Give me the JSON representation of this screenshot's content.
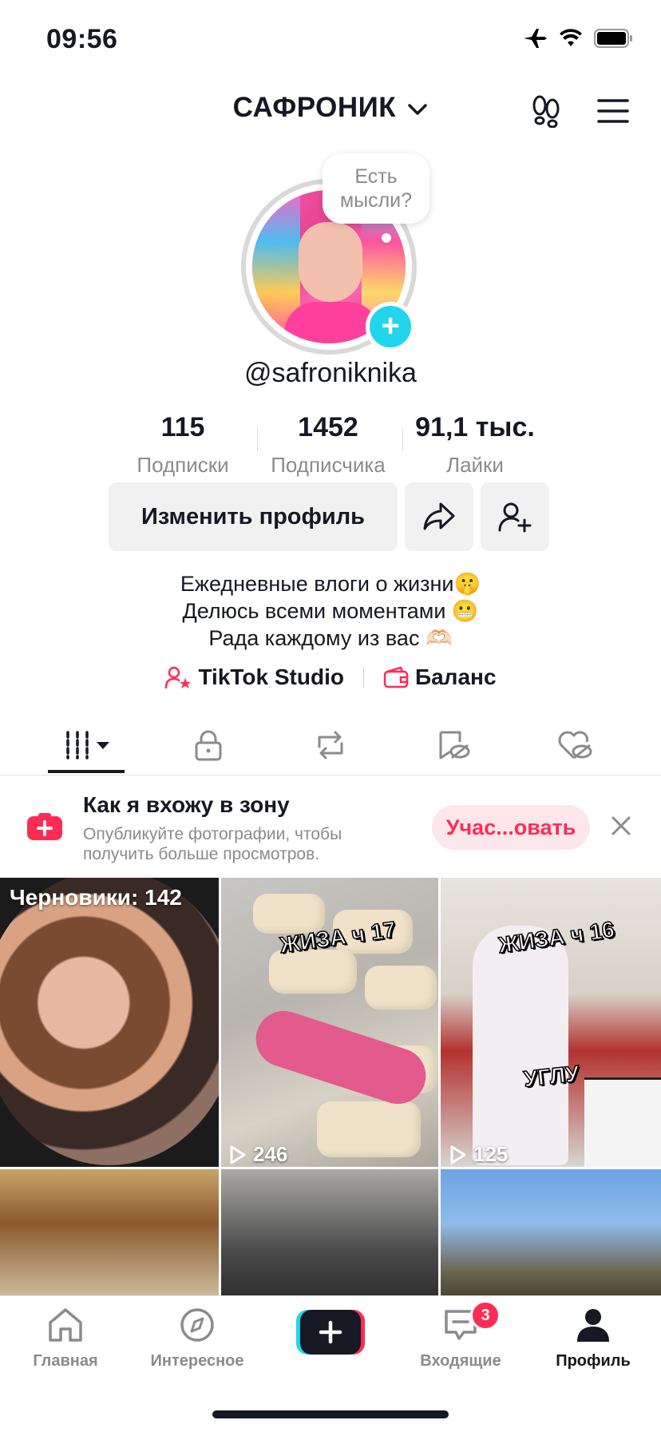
{
  "status_bar": {
    "time": "09:56"
  },
  "header": {
    "title": "САФРОНИК"
  },
  "profile": {
    "bubble": "Есть мысли?",
    "username": "@safroniknika",
    "stats": [
      {
        "value": "115",
        "label": "Подписки"
      },
      {
        "value": "1452",
        "label": "Подписчика"
      },
      {
        "value": "91,1 тыс.",
        "label": "Лайки"
      }
    ],
    "edit_button": "Изменить профиль",
    "bio": [
      "Ежедневные влоги о жизни🤫",
      "Делюсь всеми моментами 😬",
      "Рада каждому из вас 🫶🏻"
    ],
    "links": {
      "studio": "TikTok Studio",
      "balance": "Баланс"
    }
  },
  "promo": {
    "title": "Как я вхожу в зону",
    "subtitle": "Опубликуйте фотографии, чтобы получить больше просмотров.",
    "button": "Учас...овать"
  },
  "grid": {
    "drafts": "Черновики: 142",
    "items": [
      {
        "overlay": "ЖИЗА ч 17",
        "plays": "246"
      },
      {
        "overlay": "ЖИЗА ч 16",
        "overlay2": "УГЛУ",
        "plays": "125"
      }
    ]
  },
  "nav": {
    "home": "Главная",
    "discover": "Интересное",
    "inbox": "Входящие",
    "inbox_badge": "3",
    "profile": "Профиль"
  },
  "colors": {
    "accent": "#fe2c55",
    "cyan": "#20d5ec",
    "text": "#161823",
    "muted": "#8a8b91"
  }
}
